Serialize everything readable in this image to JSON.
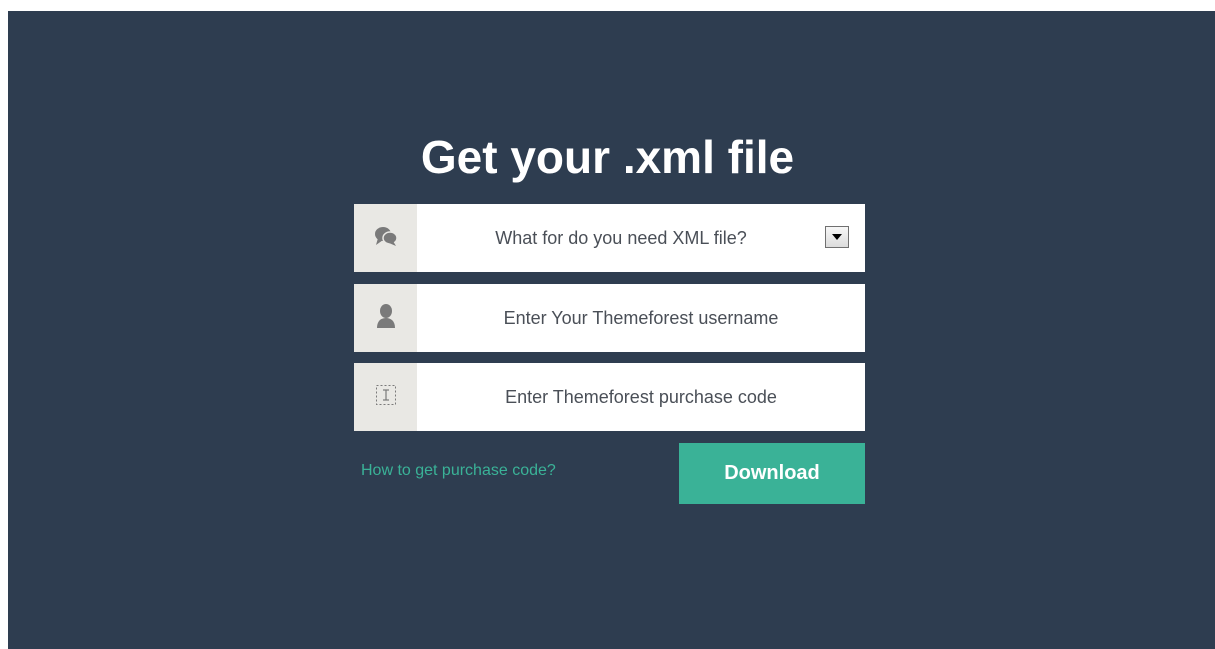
{
  "page": {
    "title": "Get your .xml file"
  },
  "form": {
    "purpose": {
      "icon": "chat-bubbles-icon",
      "selected": "What for do you need XML file?",
      "dropdown_icon": "chevron-down-icon"
    },
    "username": {
      "icon": "user-icon",
      "placeholder": "Enter Your Themeforest username",
      "value": ""
    },
    "purchase_code": {
      "icon": "text-cursor-icon",
      "placeholder": "Enter Themeforest purchase code",
      "value": ""
    }
  },
  "actions": {
    "help_link": "How to get purchase code?",
    "download_label": "Download"
  },
  "colors": {
    "background": "#2e3d50",
    "accent": "#3ab297",
    "icon_box": "#e9e8e4"
  }
}
